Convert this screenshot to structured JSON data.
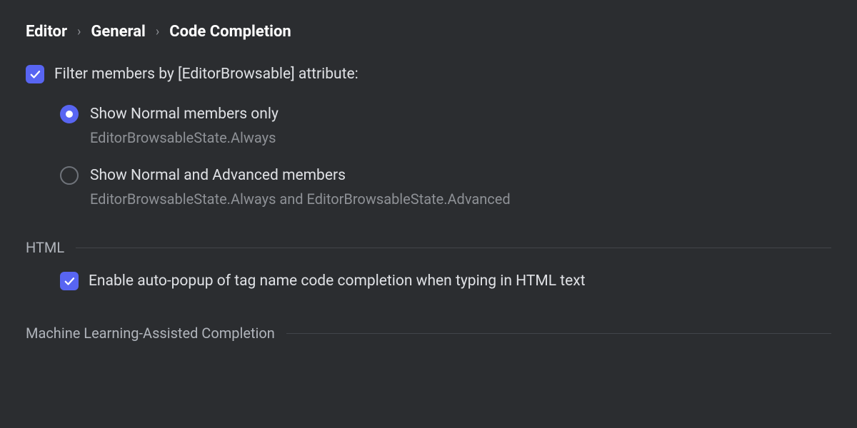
{
  "breadcrumb": {
    "items": [
      "Editor",
      "General",
      "Code Completion"
    ]
  },
  "filter": {
    "label": "Filter members by [EditorBrowsable] attribute:",
    "options": [
      {
        "label": "Show Normal members only",
        "hint": "EditorBrowsableState.Always"
      },
      {
        "label": "Show Normal and Advanced members",
        "hint": "EditorBrowsableState.Always and EditorBrowsableState.Advanced"
      }
    ]
  },
  "sections": {
    "html": {
      "title": "HTML",
      "option": "Enable auto-popup of tag name code completion when typing in HTML text"
    },
    "ml": {
      "title": "Machine Learning-Assisted Completion"
    }
  }
}
